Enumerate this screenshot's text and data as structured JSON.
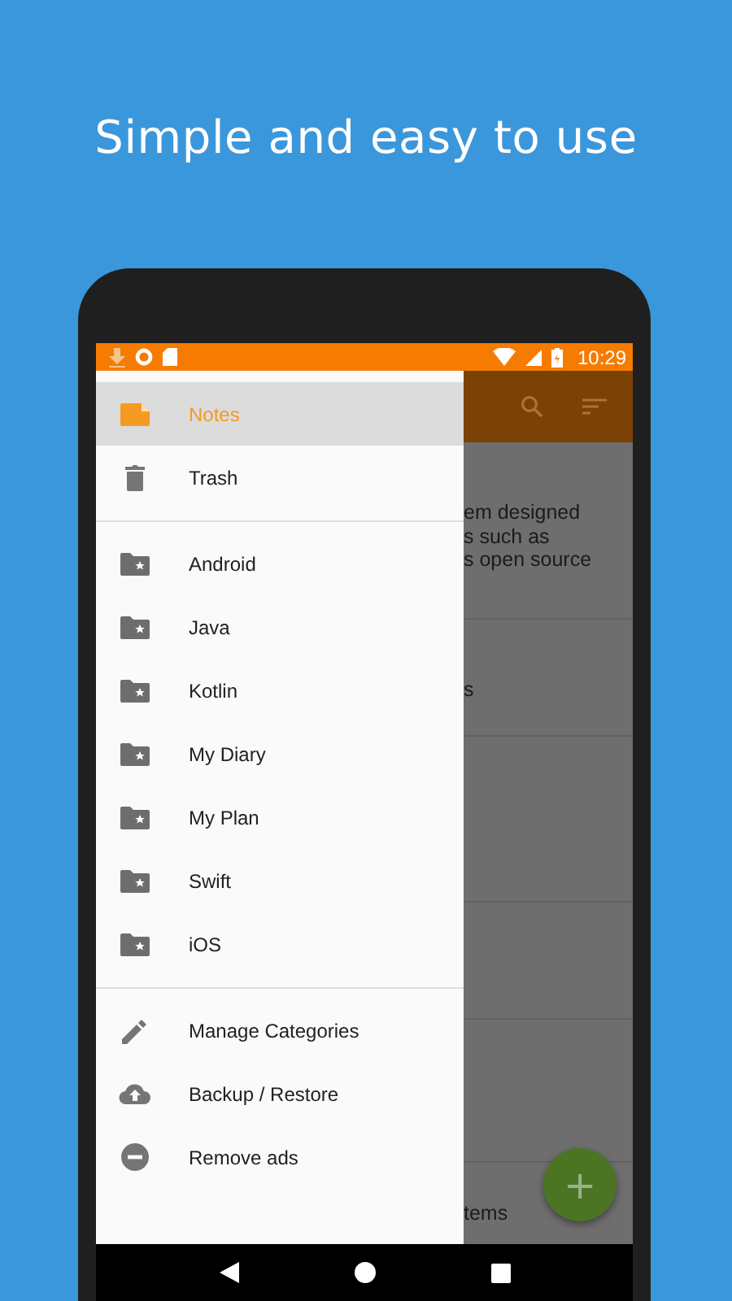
{
  "headline": "Simple and easy to use",
  "status_bar": {
    "time": "10:29"
  },
  "notes_list": [
    {
      "lines": [
        "em designed",
        "s such as",
        "s open source"
      ]
    },
    {
      "lines": [
        "s"
      ]
    },
    {
      "lines": [
        "tems"
      ]
    }
  ],
  "fab": {
    "label": "+"
  },
  "drawer": {
    "sections": [
      {
        "items": [
          {
            "kind": "note",
            "label": "Notes",
            "selected": true
          },
          {
            "kind": "trash",
            "label": "Trash",
            "selected": false
          }
        ]
      },
      {
        "items": [
          {
            "kind": "folder",
            "label": "Android",
            "selected": false
          },
          {
            "kind": "folder",
            "label": "Java",
            "selected": false
          },
          {
            "kind": "folder",
            "label": "Kotlin",
            "selected": false
          },
          {
            "kind": "folder",
            "label": "My Diary",
            "selected": false
          },
          {
            "kind": "folder",
            "label": "My Plan",
            "selected": false
          },
          {
            "kind": "folder",
            "label": "Swift",
            "selected": false
          },
          {
            "kind": "folder",
            "label": "iOS",
            "selected": false
          }
        ]
      },
      {
        "items": [
          {
            "kind": "edit",
            "label": "Manage Categories",
            "selected": false
          },
          {
            "kind": "backup",
            "label": "Backup / Restore",
            "selected": false
          },
          {
            "kind": "remove",
            "label": "Remove ads",
            "selected": false
          }
        ]
      }
    ]
  }
}
